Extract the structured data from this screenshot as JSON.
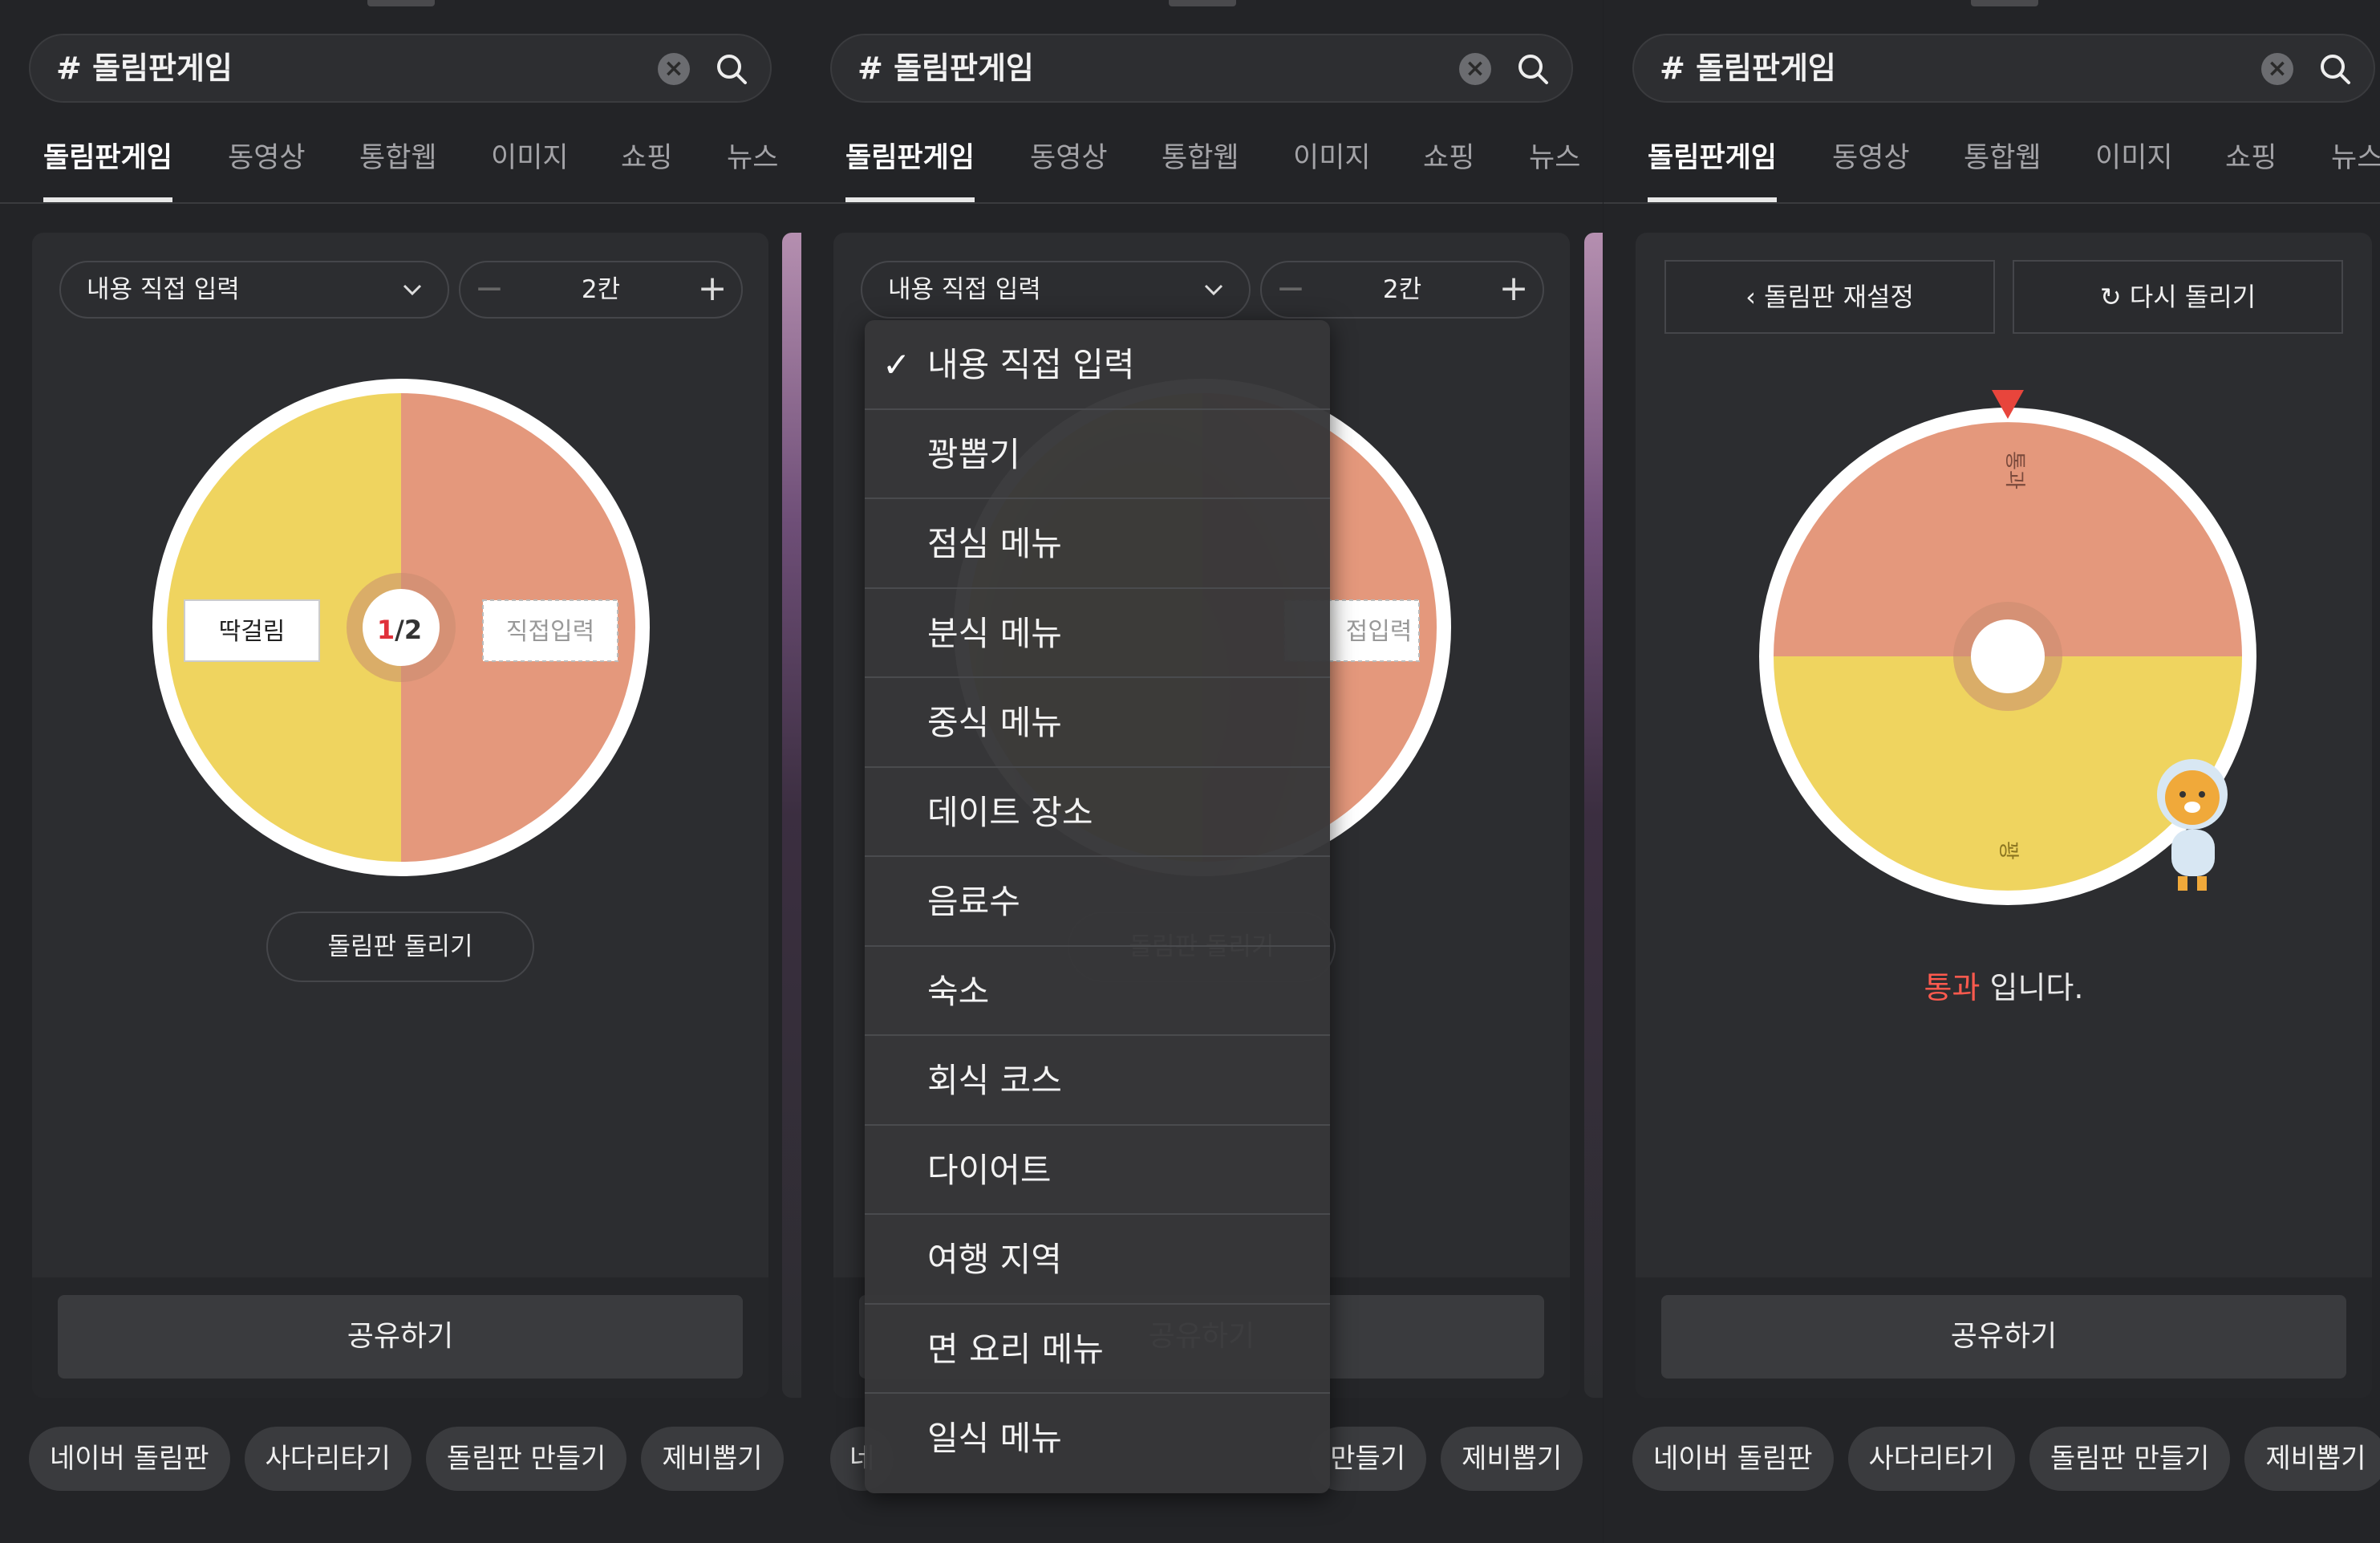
{
  "search": {
    "query": "# 돌림판게임"
  },
  "tabs": [
    "돌림판게임",
    "동영상",
    "통합웹",
    "이미지",
    "쇼핑",
    "뉴스"
  ],
  "controls": {
    "select_value": "내용 직접 입력",
    "stepper_value": "2칸"
  },
  "wheel": {
    "segments": [
      {
        "label": "딱걸림",
        "color": "#efd45f"
      },
      {
        "label": "직접입력",
        "color": "#e4987c"
      }
    ],
    "center_label_current": "1",
    "center_label_total": "/2"
  },
  "spin_button": "돌림판 돌리기",
  "share_button": "공유하기",
  "chips": [
    "네이버 돌림판",
    "사다리타기",
    "돌림판 만들기",
    "제비뽑기"
  ],
  "dropdown": {
    "selected": "내용 직접 입력",
    "options": [
      "내용 직접 입력",
      "꽝뽑기",
      "점심 메뉴",
      "분식 메뉴",
      "중식 메뉴",
      "데이트 장소",
      "음료수",
      "숙소",
      "회식 코스",
      "다이어트",
      "여행 지역",
      "면 요리 메뉴",
      "일식 메뉴"
    ]
  },
  "panel2_partial": {
    "segment_label": "접입력",
    "chip_first": "네",
    "chip_third": "만들기"
  },
  "result": {
    "back_button": "돌림판 재설정",
    "retry_button": "다시 돌리기",
    "top_label": "통과",
    "bottom_label": "꽝",
    "result_word": "통과",
    "result_suffix": " 입니다."
  },
  "colors": {
    "accent_red": "#ff5a4e",
    "yellow": "#efd45f",
    "salmon": "#e4987c"
  }
}
